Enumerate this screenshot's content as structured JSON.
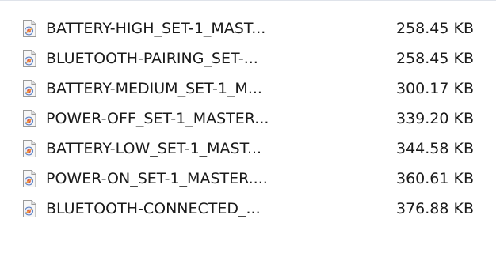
{
  "file_list": {
    "icon": "audio-file-icon",
    "rows": [
      {
        "name": "BATTERY-HIGH_SET-1_MAST...",
        "size": "258.45 KB"
      },
      {
        "name": "BLUETOOTH-PAIRING_SET-...",
        "size": "258.45 KB"
      },
      {
        "name": "BATTERY-MEDIUM_SET-1_M...",
        "size": "300.17 KB"
      },
      {
        "name": "POWER-OFF_SET-1_MASTER...",
        "size": "339.20 KB"
      },
      {
        "name": "BATTERY-LOW_SET-1_MAST...",
        "size": "344.58 KB"
      },
      {
        "name": "POWER-ON_SET-1_MASTER....",
        "size": "360.61 KB"
      },
      {
        "name": "BLUETOOTH-CONNECTED_...",
        "size": "376.88 KB"
      }
    ]
  }
}
